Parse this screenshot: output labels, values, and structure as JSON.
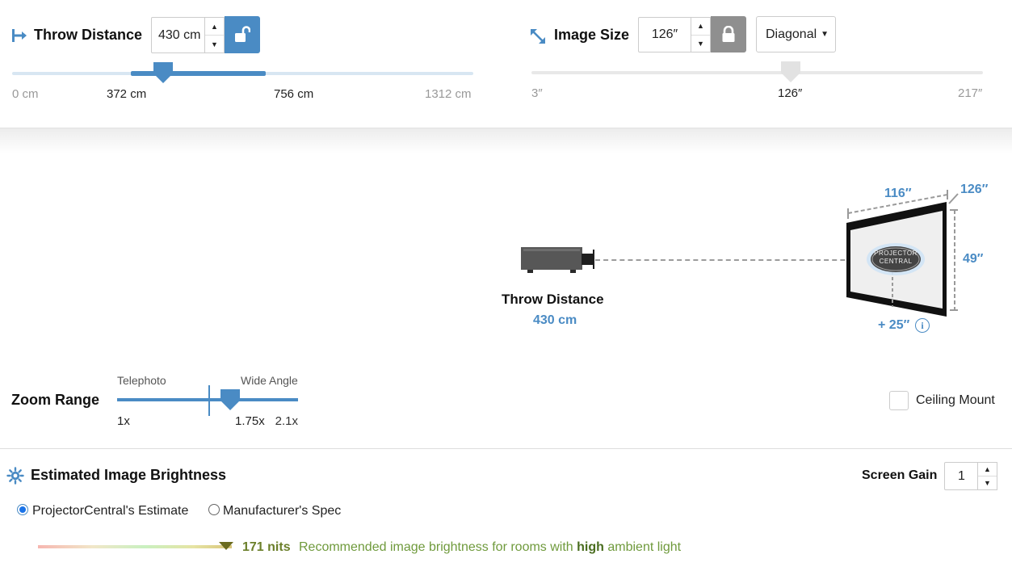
{
  "throw_distance": {
    "title": "Throw Distance",
    "value": "430 cm",
    "lock_icon": "unlocked-padlock-icon",
    "slider": {
      "min_label": "0 cm",
      "range_start_label": "372 cm",
      "range_end_label": "756 cm",
      "max_label": "1312 cm",
      "min_cm": 0,
      "max_cm": 1312,
      "range_start_cm": 372,
      "range_end_cm": 756,
      "current_cm": 430
    }
  },
  "image_size": {
    "title": "Image Size",
    "value": "126″",
    "lock_icon": "locked-padlock-icon",
    "measure_select": "Diagonal",
    "slider": {
      "min_label": "3″",
      "current_label": "126″",
      "max_label": "217″",
      "min_in": 3,
      "max_in": 217,
      "current_in": 126
    }
  },
  "diagram": {
    "throw_label": "Throw Distance",
    "throw_value": "430 cm",
    "width_dim": "116″",
    "diagonal_dim": "126″",
    "height_dim": "49″",
    "offset_dim": "+ 25″",
    "screen_logo_line1": "PROJECTOR",
    "screen_logo_line2": "CENTRAL"
  },
  "zoom": {
    "title": "Zoom Range",
    "telephoto_label": "Telephoto",
    "wide_label": "Wide Angle",
    "min_label": "1x",
    "current_label": "1.75x",
    "max_label": "2.1x",
    "min": 1,
    "max": 2.1,
    "current": 1.75
  },
  "ceiling_mount": {
    "label": "Ceiling Mount",
    "checked": false
  },
  "brightness": {
    "title": "Estimated Image Brightness",
    "screen_gain_label": "Screen Gain",
    "screen_gain_value": "1",
    "estimate_option": "ProjectorCentral's Estimate",
    "manufacturer_option": "Manufacturer's Spec",
    "selected_option": "estimate",
    "nits": "171 nits",
    "recommend_prefix": "Recommended image brightness for rooms with ",
    "recommend_bold": "high",
    "recommend_suffix": " ambient light"
  },
  "colors": {
    "accent": "#4a8bc4",
    "lock_unlocked_bg": "#4a8bc4",
    "lock_locked_bg": "#8f8f8f",
    "nits_text": "#6b7f2a"
  }
}
